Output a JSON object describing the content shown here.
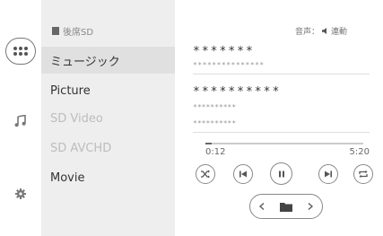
{
  "header": {
    "source_label": "後席SD",
    "audio_status_label": "音声：",
    "audio_status_value": "連動"
  },
  "sources": [
    {
      "label": "ミュージック",
      "state": "active"
    },
    {
      "label": "Picture",
      "state": "enabled"
    },
    {
      "label": "SD Video",
      "state": "disabled"
    },
    {
      "label": "SD AVCHD",
      "state": "disabled"
    },
    {
      "label": "Movie",
      "state": "enabled"
    }
  ],
  "track": {
    "title": "*******",
    "subtitle": "***************",
    "artist": "**********",
    "album": "**********",
    "genre": "**********"
  },
  "playback": {
    "elapsed": "0:12",
    "total": "5:20",
    "progress_fraction": 0.04
  },
  "icons": {
    "apps": "apps-grid-icon",
    "music": "music-note-icon",
    "settings": "gear-icon",
    "shuffle": "shuffle-icon",
    "previous": "skip-previous-icon",
    "pause": "pause-icon",
    "next": "skip-next-icon",
    "repeat": "repeat-icon",
    "folder": "folder-icon"
  },
  "colors": {
    "panel_bg": "#eeeeee",
    "active_item_bg": "#e0e0e0",
    "disabled_text": "#bdbdbd"
  }
}
